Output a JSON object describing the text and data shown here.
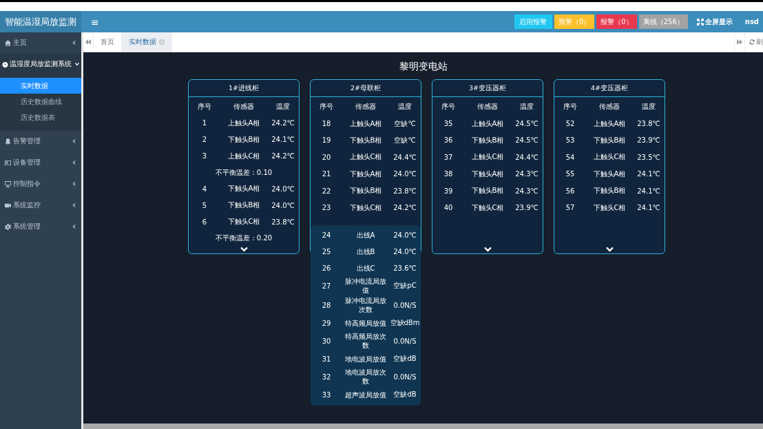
{
  "header": {
    "logo": "智能温湿局放监测",
    "menu_toggle": "≡",
    "buttons": [
      {
        "label": "启用报警",
        "color": "#1fc8f0"
      },
      {
        "label": "预警（0）",
        "color": "#fbc02d"
      },
      {
        "label": "报警（0）",
        "color": "#e8384f"
      },
      {
        "label": "离线（256）",
        "color": "#a3a3a3"
      }
    ],
    "fullscreen": "全屏显示",
    "user": "nsd"
  },
  "sidebar": {
    "items": [
      {
        "label": "主页",
        "expanded": false
      },
      {
        "label": "温湿度局放监测系统",
        "expanded": true,
        "children": [
          {
            "label": "实时数据",
            "selected": true
          },
          {
            "label": "历史数据曲线",
            "selected": false
          },
          {
            "label": "历史数据表",
            "selected": false
          }
        ]
      },
      {
        "label": "告警管理",
        "expanded": false
      },
      {
        "label": "设备管理",
        "expanded": false
      },
      {
        "label": "控制指令",
        "expanded": false
      },
      {
        "label": "系统监控",
        "expanded": false
      },
      {
        "label": "系统管理",
        "expanded": false
      }
    ]
  },
  "tabs": [
    {
      "label": "首页",
      "selected": false,
      "closable": false
    },
    {
      "label": "实时数据",
      "selected": true,
      "closable": true
    }
  ],
  "refresh": "刷",
  "station": {
    "title": "黎明变电站",
    "cabinets": [
      {
        "title": "1#进线柜",
        "expanded": false,
        "columns": [
          "序号",
          "传感器",
          "温度"
        ],
        "rows": [
          {
            "kind": "row",
            "cells": [
              "1",
              "上触头A相",
              "24.2℃"
            ]
          },
          {
            "kind": "row",
            "cells": [
              "2",
              "下触头B相",
              "24.1℃"
            ]
          },
          {
            "kind": "row",
            "cells": [
              "3",
              "上触头C相",
              "24.2℃"
            ]
          },
          {
            "kind": "note",
            "text": "不平衡温差：0.10"
          },
          {
            "kind": "row",
            "cells": [
              "4",
              "下触头A相",
              "24.0℃"
            ]
          },
          {
            "kind": "row",
            "cells": [
              "5",
              "下触头B相",
              "24.0℃"
            ]
          },
          {
            "kind": "row",
            "cells": [
              "6",
              "下触头C相",
              "23.8℃"
            ]
          },
          {
            "kind": "note",
            "text": "不平衡温差：0.20"
          }
        ]
      },
      {
        "title": "2#母联柜",
        "expanded": true,
        "columns": [
          "序号",
          "传感器",
          "温度"
        ],
        "rows": [
          {
            "kind": "row",
            "cells": [
              "18",
              "上触头A相",
              "空缺℃"
            ]
          },
          {
            "kind": "row",
            "cells": [
              "19",
              "下触头B相",
              "空缺℃"
            ]
          },
          {
            "kind": "row",
            "cells": [
              "20",
              "上触头C相",
              "24.4℃"
            ]
          },
          {
            "kind": "row",
            "cells": [
              "21",
              "下触头A相",
              "24.0℃"
            ]
          },
          {
            "kind": "row",
            "cells": [
              "22",
              "下触头B相",
              "23.8℃"
            ]
          },
          {
            "kind": "row",
            "cells": [
              "23",
              "下触头C相",
              "24.2℃"
            ]
          }
        ],
        "more_rows": [
          {
            "kind": "row",
            "cells": [
              "24",
              "出线A",
              "24.0℃"
            ]
          },
          {
            "kind": "row",
            "cells": [
              "25",
              "出线B",
              "24.0℃"
            ]
          },
          {
            "kind": "row",
            "cells": [
              "26",
              "出线C",
              "23.6℃"
            ]
          },
          {
            "kind": "row",
            "cells": [
              "27",
              "脉冲电流局放值",
              "空缺pC"
            ]
          },
          {
            "kind": "row",
            "cells": [
              "28",
              "脉冲电流局放次数",
              "0.0N/S"
            ]
          },
          {
            "kind": "row",
            "cells": [
              "29",
              "特高频局放值",
              "空缺dBm"
            ]
          },
          {
            "kind": "row",
            "cells": [
              "30",
              "特高频局放次数",
              "0.0N/S"
            ]
          },
          {
            "kind": "row",
            "cells": [
              "31",
              "地电波局放值",
              "空缺dB"
            ]
          },
          {
            "kind": "row",
            "cells": [
              "32",
              "地电波局放次数",
              "0.0N/S"
            ]
          },
          {
            "kind": "row",
            "cells": [
              "33",
              "超声波局放值",
              "空缺dB"
            ]
          }
        ]
      },
      {
        "title": "3#变压器柜",
        "expanded": false,
        "columns": [
          "序号",
          "传感器",
          "温度"
        ],
        "rows": [
          {
            "kind": "row",
            "cells": [
              "35",
              "上触头A相",
              "24.5℃"
            ]
          },
          {
            "kind": "row",
            "cells": [
              "36",
              "下触头B相",
              "24.5℃"
            ]
          },
          {
            "kind": "row",
            "cells": [
              "37",
              "上触头C相",
              "24.4℃"
            ]
          },
          {
            "kind": "row",
            "cells": [
              "38",
              "下触头A相",
              "24.3℃"
            ]
          },
          {
            "kind": "row",
            "cells": [
              "39",
              "下触头B相",
              "24.3℃"
            ]
          },
          {
            "kind": "row",
            "cells": [
              "40",
              "下触头C相",
              "23.9℃"
            ]
          }
        ]
      },
      {
        "title": "4#变压器柜",
        "expanded": false,
        "columns": [
          "序号",
          "传感器",
          "温度"
        ],
        "rows": [
          {
            "kind": "row",
            "cells": [
              "52",
              "上触头A相",
              "23.8℃"
            ]
          },
          {
            "kind": "row",
            "cells": [
              "53",
              "下触头B相",
              "23.9℃"
            ]
          },
          {
            "kind": "row",
            "cells": [
              "54",
              "上触头C相",
              "23.5℃"
            ]
          },
          {
            "kind": "row",
            "cells": [
              "55",
              "下触头A相",
              "24.1℃"
            ]
          },
          {
            "kind": "row",
            "cells": [
              "56",
              "下触头B相",
              "24.1℃"
            ]
          },
          {
            "kind": "row",
            "cells": [
              "57",
              "下触头C相",
              "24.1℃"
            ]
          }
        ]
      }
    ]
  }
}
